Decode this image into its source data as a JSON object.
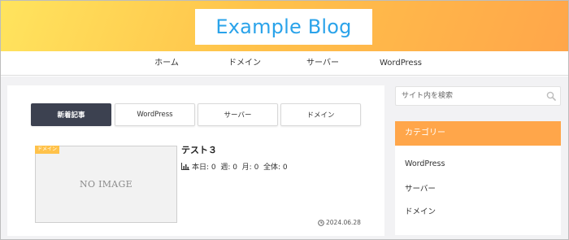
{
  "header": {
    "site_title": "Example Blog"
  },
  "nav": {
    "items": [
      {
        "label": "ホーム"
      },
      {
        "label": "ドメイン"
      },
      {
        "label": "サーバー"
      },
      {
        "label": "WordPress"
      }
    ]
  },
  "tabs": [
    {
      "label": "新着記事",
      "active": true
    },
    {
      "label": "WordPress",
      "active": false
    },
    {
      "label": "サーバー",
      "active": false
    },
    {
      "label": "ドメイン",
      "active": false
    }
  ],
  "post": {
    "category": "ドメイン",
    "thumbnail_text": "NO IMAGE",
    "title": "テスト３",
    "stats": "本日: 0  週: 0  月: 0  全体: 0",
    "date": "2024.06.28"
  },
  "sidebar": {
    "search_placeholder": "サイト内を検索",
    "widget_title": "カテゴリー",
    "categories": [
      {
        "label": "WordPress"
      },
      {
        "label": "サーバー"
      },
      {
        "label": "ドメイン"
      }
    ]
  },
  "colors": {
    "accent_orange": "#ffa64a",
    "logo_blue": "#2aa3ea",
    "active_tab": "#3c4150"
  }
}
